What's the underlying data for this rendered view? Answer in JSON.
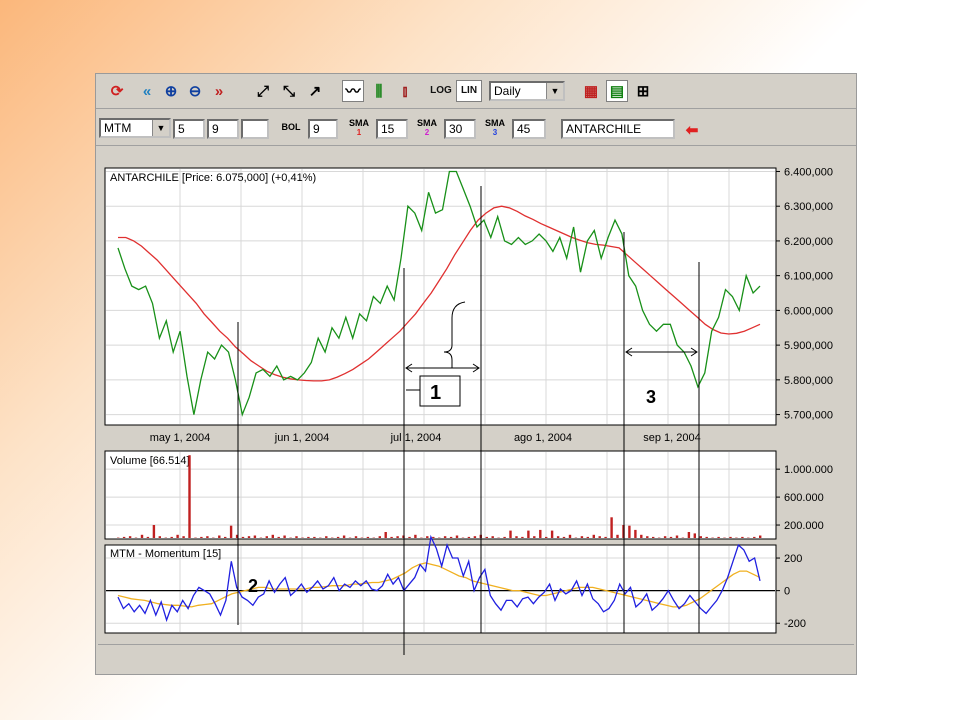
{
  "toolbar": {
    "log_label": "LOG",
    "lin_label": "LIN",
    "period": "Daily",
    "indicator": "MTM",
    "param1": "5",
    "param2": "9",
    "param3": "",
    "bol_label": "BOL",
    "bol_value": "9",
    "sma1_label": "SMA",
    "sma1_num": "1",
    "sma1_value": "15",
    "sma2_label": "SMA",
    "sma2_num": "2",
    "sma2_value": "30",
    "sma3_label": "SMA",
    "sma3_num": "3",
    "sma3_value": "45",
    "symbol": "ANTARCHILE"
  },
  "colors": {
    "price_line": "#189018",
    "sma_line": "#e03030",
    "volume_bar": "#c02020",
    "mtm_line": "#2020e0",
    "mtm_signal": "#f0b020",
    "grid": "#d8d8d8",
    "annotation": "#000000"
  },
  "chart_data": [
    {
      "type": "line",
      "title": "ANTARCHILE [Price: 6.075,000] (+0,41%)",
      "x_tick_labels": [
        "may 1, 2004",
        "jun 1, 2004",
        "jul 1, 2004",
        "ago 1, 2004",
        "sep 1, 2004"
      ],
      "y_tick_labels": [
        "6.400,000",
        "6.300,000",
        "6.200,000",
        "6.100,000",
        "6.000,000",
        "5.900,000",
        "5.800,000",
        "5.700,000"
      ],
      "ylim": [
        5670,
        6410
      ],
      "grid": true,
      "series": [
        {
          "values": [
            6180,
            6120,
            6070,
            6060,
            6070,
            6020,
            5920,
            5970,
            5880,
            5940,
            5810,
            5700,
            5800,
            5880,
            5860,
            5900,
            5880,
            5800,
            5700,
            5750,
            5820,
            5830,
            5810,
            5840,
            5800,
            5810,
            5800,
            5820,
            5850,
            5920,
            5880,
            5950,
            5920,
            5980,
            5920,
            5990,
            5970,
            6040,
            6020,
            6070,
            6030,
            6150,
            6300,
            6280,
            6230,
            6340,
            6280,
            6290,
            6400,
            6400,
            6350,
            6300,
            6240,
            6260,
            6210,
            6270,
            6200,
            6190,
            6210,
            6190,
            6200,
            6220,
            6200,
            6170,
            6210,
            6150,
            6240,
            6110,
            6200,
            6230,
            6150,
            6210,
            6260,
            6220,
            6100,
            6070,
            6000,
            5960,
            5940,
            5960,
            5960,
            5900,
            5880,
            5840,
            5780,
            5820,
            5940,
            5980,
            6060,
            6040,
            6000,
            6100,
            6050,
            6070
          ]
        },
        {
          "values": [
            6210,
            6210,
            6200,
            6185,
            6165,
            6145,
            6120,
            6095,
            6070,
            6045,
            6020,
            5990,
            5965,
            5940,
            5920,
            5895,
            5875,
            5855,
            5840,
            5825,
            5815,
            5808,
            5803,
            5800,
            5798,
            5797,
            5797,
            5800,
            5808,
            5818,
            5830,
            5845,
            5860,
            5880,
            5900,
            5920,
            5940,
            5965,
            5990,
            6020,
            6050,
            6085,
            6120,
            6160,
            6195,
            6230,
            6260,
            6280,
            6295,
            6300,
            6295,
            6285,
            6272,
            6262,
            6250,
            6240,
            6230,
            6220,
            6210,
            6202,
            6195,
            6190,
            6188,
            6184,
            6180,
            6160,
            6140,
            6120,
            6100,
            6080,
            6060,
            6040,
            6020,
            6000,
            5980,
            5960,
            5945,
            5935,
            5932,
            5934,
            5940,
            5950,
            5960
          ]
        }
      ]
    },
    {
      "type": "bar",
      "title": "Volume [66.514]",
      "y_tick_labels": [
        "1.000.000",
        "600.000",
        "200.000"
      ],
      "ylim": [
        0,
        1260000
      ],
      "values": [
        20000,
        30000,
        40000,
        20000,
        60000,
        30000,
        200000,
        40000,
        20000,
        30000,
        60000,
        40000,
        1200000,
        20000,
        30000,
        40000,
        20000,
        50000,
        30000,
        190000,
        60000,
        30000,
        40000,
        50000,
        20000,
        40000,
        60000,
        30000,
        50000,
        20000,
        40000,
        20000,
        30000,
        30000,
        20000,
        40000,
        20000,
        30000,
        50000,
        20000,
        40000,
        20000,
        30000,
        20000,
        40000,
        100000,
        30000,
        40000,
        50000,
        30000,
        60000,
        20000,
        40000,
        30000,
        20000,
        40000,
        30000,
        50000,
        20000,
        30000,
        40000,
        60000,
        30000,
        40000,
        20000,
        30000,
        120000,
        40000,
        30000,
        120000,
        40000,
        130000,
        30000,
        120000,
        40000,
        30000,
        60000,
        20000,
        40000,
        30000,
        60000,
        40000,
        30000,
        310000,
        60000,
        200000,
        190000,
        130000,
        60000,
        40000,
        30000,
        20000,
        40000,
        30000,
        50000,
        20000,
        100000,
        80000,
        40000,
        30000,
        20000,
        30000,
        20000,
        30000,
        20000,
        30000,
        20000,
        30000,
        50000
      ]
    },
    {
      "type": "line",
      "title": "MTM - Momentum [15]",
      "y_tick_labels": [
        "200",
        "0",
        "-200"
      ],
      "ylim": [
        -260,
        280
      ],
      "series": [
        {
          "values": [
            -40,
            -110,
            -80,
            -130,
            -90,
            -140,
            -60,
            -150,
            -70,
            -180,
            -90,
            -130,
            -60,
            -110,
            -30,
            20,
            0,
            -20,
            -80,
            -150,
            -60,
            180,
            20,
            -40,
            -60,
            -90,
            -40,
            -20,
            60,
            -10,
            40,
            80,
            -30,
            0,
            40,
            -10,
            20,
            60,
            10,
            30,
            80,
            0,
            40,
            20,
            60,
            30,
            60,
            10,
            0,
            30,
            100,
            40,
            80,
            0,
            40,
            80,
            160,
            120,
            330,
            260,
            150,
            280,
            200,
            200,
            90,
            180,
            0,
            80,
            130,
            -30,
            -80,
            -120,
            -60,
            -60,
            -100,
            -50,
            -40,
            -80,
            -40,
            -10,
            40,
            -60,
            10,
            -20,
            0,
            60,
            -30,
            40,
            -50,
            -80,
            -130,
            -110,
            -60,
            40,
            -20,
            20,
            -100,
            -70,
            -20,
            -120,
            -90,
            -50,
            0,
            -60,
            -110,
            -80,
            -30,
            -70,
            -110,
            -140,
            -100,
            -60,
            0,
            80,
            180,
            280,
            250,
            180,
            200,
            60
          ]
        },
        {
          "values": [
            -30,
            -40,
            -50,
            -55,
            -60,
            -70,
            -80,
            -85,
            -90,
            -90,
            -95,
            -100,
            -90,
            -85,
            -80,
            -60,
            -40,
            -20,
            -10,
            0,
            10,
            20,
            20,
            10,
            10,
            10,
            10,
            10,
            10,
            20,
            20,
            25,
            30,
            30,
            30,
            40,
            40,
            45,
            50,
            50,
            60,
            70,
            90,
            110,
            140,
            160,
            170,
            160,
            150,
            130,
            110,
            90,
            80,
            60,
            50,
            40,
            30,
            20,
            10,
            0,
            0,
            -10,
            -20,
            -30,
            -30,
            -20,
            -10,
            0,
            10,
            20,
            20,
            20,
            10,
            0,
            -10,
            -20,
            -30,
            -40,
            -50,
            -60,
            -70,
            -80,
            -90,
            -100,
            -100,
            -90,
            -70,
            -50,
            -20,
            10,
            40,
            70,
            100,
            120,
            120,
            100,
            80
          ]
        }
      ]
    }
  ],
  "annotations": {
    "label1": "1",
    "label2": "2",
    "label3": "3"
  }
}
